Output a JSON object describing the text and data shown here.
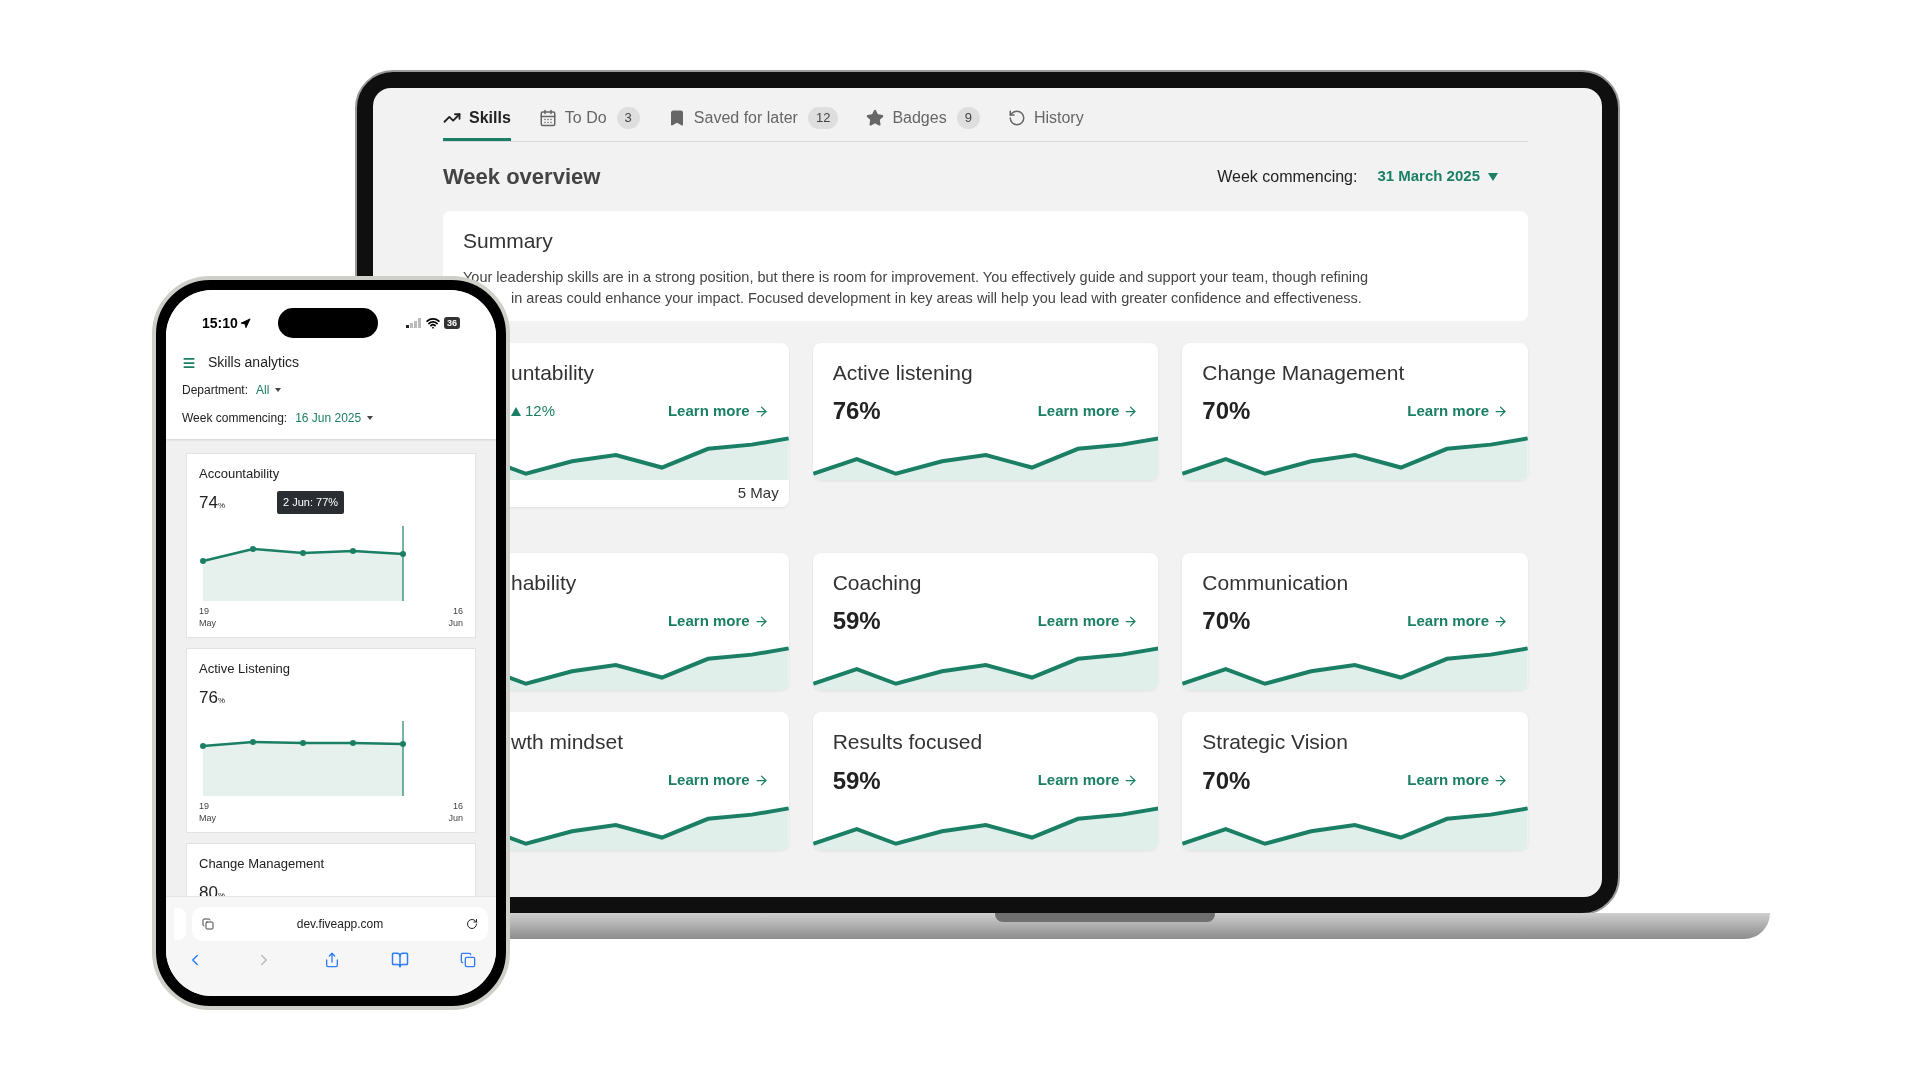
{
  "laptop": {
    "tabs": [
      {
        "label": "Skills",
        "selected": true
      },
      {
        "label": "To Do",
        "count": "3",
        "selected": false
      },
      {
        "label": "Saved for later",
        "count": "12",
        "selected": false
      },
      {
        "label": "Badges",
        "count": "9",
        "selected": false
      },
      {
        "label": "History",
        "selected": false
      }
    ],
    "page_title": "Week overview",
    "week_label": "Week commencing:",
    "week_value": "31 March 2025",
    "summary": {
      "title": "Summary",
      "lines": [
        "Your leadership skills are in a strong position, but there is room for improvement. You effectively guide and support your team, though refining",
        "in areas could enhance your impact. Focused development in key areas will help you lead with greater confidence and effectiveness."
      ]
    },
    "skills": [
      {
        "name": "untability",
        "change": "12%",
        "date": "5 May",
        "link": "Learn more"
      },
      {
        "name": "Active listening",
        "score": "76%",
        "link": "Learn more"
      },
      {
        "name": "Change Management",
        "score": "70%",
        "link": "Learn more"
      },
      {
        "name": "hability",
        "link": "Learn more"
      },
      {
        "name": "Coaching",
        "score": "59%",
        "link": "Learn more"
      },
      {
        "name": "Communication",
        "score": "70%",
        "link": "Learn more"
      },
      {
        "name": "wth mindset",
        "link": "Learn more"
      },
      {
        "name": "Results focused",
        "score": "59%",
        "link": "Learn more"
      },
      {
        "name": "Strategic Vision",
        "score": "70%",
        "link": "Learn more"
      }
    ]
  },
  "phone": {
    "time": "15:10",
    "battery": "36",
    "title": "Skills analytics",
    "department_label": "Department:",
    "department_value": "All",
    "week_label": "Week commencing:",
    "week_value": "16 Jun 2025",
    "cards": [
      {
        "name": "Accountability",
        "score": "74",
        "unit": "%",
        "tooltip": "2 Jun: 77%",
        "axis_start": {
          "day": "19",
          "month": "May"
        },
        "axis_end": {
          "day": "16",
          "month": "Jun"
        }
      },
      {
        "name": "Active Listening",
        "score": "76",
        "unit": "%",
        "axis_start": {
          "day": "19",
          "month": "May"
        },
        "axis_end": {
          "day": "16",
          "month": "Jun"
        }
      },
      {
        "name": "Change Management",
        "score": "80",
        "unit": "%"
      }
    ],
    "url": "dev.fiveapp.com"
  }
}
